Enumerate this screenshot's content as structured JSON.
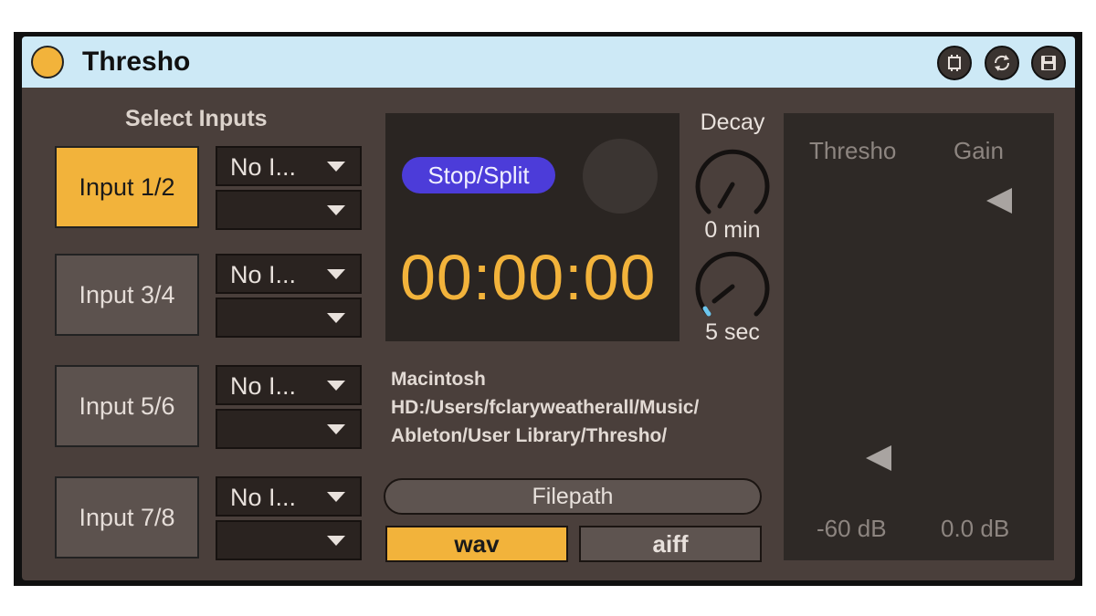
{
  "device": {
    "title": "Thresho",
    "icons": {
      "power": "power-led",
      "buttons": [
        "expand-icon",
        "refresh-icon",
        "save-icon"
      ]
    }
  },
  "inputs": {
    "heading": "Select Inputs",
    "buttons": [
      "Input 1/2",
      "Input 3/4",
      "Input 5/6",
      "Input 7/8"
    ],
    "active_index": 0,
    "dropdowns": [
      {
        "top": "No I...",
        "bottom": ""
      },
      {
        "top": "No I...",
        "bottom": ""
      },
      {
        "top": "No I...",
        "bottom": ""
      },
      {
        "top": "No I...",
        "bottom": ""
      }
    ]
  },
  "recorder": {
    "stop_split_label": "Stop/Split",
    "time": "00:00:00"
  },
  "decay": {
    "heading": "Decay",
    "knob1_value": "0 min",
    "knob2_value": "5 sec"
  },
  "filepath": {
    "line1": "Macintosh",
    "line2": "HD:/Users/fclaryweatherall/Music/",
    "line3": "Ableton/User Library/Thresho/",
    "button_label": "Filepath"
  },
  "format": {
    "wav_label": "wav",
    "aiff_label": "aiff",
    "selected": "wav"
  },
  "meter": {
    "thresho_label": "Thresho",
    "gain_label": "Gain",
    "thresho_value": "-60 dB",
    "gain_value": "0.0 dB"
  },
  "colors": {
    "accent": "#f2b33b",
    "button_blue": "#4c3cd9",
    "titlebar": "#cde9f6",
    "body": "#4a3f3b"
  }
}
